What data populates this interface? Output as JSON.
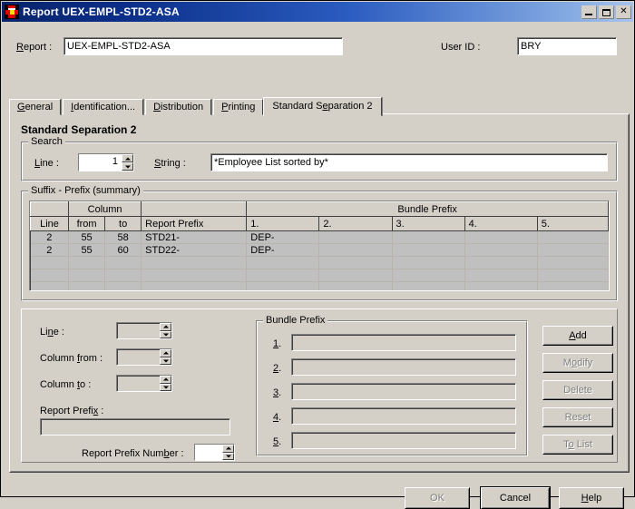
{
  "window": {
    "title": "Report UEX-EMPL-STD2-ASA",
    "icon": "report-document-icon",
    "controls": {
      "minimize": "minimize-icon",
      "maximize": "maximize-icon",
      "close": "✕"
    }
  },
  "header": {
    "report_label": "Report :",
    "report_label_accel": "R",
    "report_value": "UEX-EMPL-STD2-ASA",
    "userid_label": "User ID :",
    "userid_value": "BRY"
  },
  "tabs": [
    {
      "label": "General",
      "accel": "G",
      "active": false
    },
    {
      "label": "Identification...",
      "accel": "I",
      "active": false
    },
    {
      "label": "Distribution",
      "accel": "D",
      "active": false
    },
    {
      "label": "Printing",
      "accel": "P",
      "active": false
    },
    {
      "label": "Standard Separation 2",
      "accel": "e",
      "active": true
    }
  ],
  "panel": {
    "title": "Standard Separation 2"
  },
  "search_group": {
    "legend": "Search",
    "line_label": "Line :",
    "line_value": "1",
    "string_label": "String :",
    "string_value": "*Employee List sorted by*"
  },
  "summary_group": {
    "legend": "Suffix - Prefix (summary)",
    "header_top": {
      "blank_left": "",
      "column": "Column",
      "blank_mid": "",
      "bundle_prefix": "Bundle Prefix"
    },
    "columns": [
      "Line",
      "from",
      "to",
      "Report Prefix",
      "1.",
      "2.",
      "3.",
      "4.",
      "5."
    ],
    "rows": [
      {
        "line": "2",
        "from": "55",
        "to": "58",
        "report_prefix": "STD21-",
        "b1": "DEP-",
        "b2": "",
        "b3": "",
        "b4": "",
        "b5": "",
        "selected": true
      },
      {
        "line": "2",
        "from": "55",
        "to": "60",
        "report_prefix": "STD22-",
        "b1": "DEP-",
        "b2": "",
        "b3": "",
        "b4": "",
        "b5": "",
        "selected": true
      }
    ],
    "empty_rows": 4
  },
  "detail_form": {
    "line_label": "Line :",
    "line_value": "",
    "line_enabled": false,
    "column_from_label": "Column from :",
    "column_from_value": "",
    "column_from_enabled": false,
    "column_to_label": "Column to :",
    "column_to_value": "",
    "column_to_enabled": false,
    "report_prefix_label": "Report Prefix :",
    "report_prefix_value": "",
    "report_prefix_number_label": "Report Prefix Number :",
    "report_prefix_number_value": "",
    "report_prefix_number_enabled": true
  },
  "bundle_prefix_group": {
    "legend": "Bundle Prefix",
    "fields": [
      {
        "label": "1.",
        "accel": "1",
        "value": ""
      },
      {
        "label": "2.",
        "accel": "2",
        "value": ""
      },
      {
        "label": "3.",
        "accel": "3",
        "value": ""
      },
      {
        "label": "4.",
        "accel": "4",
        "value": ""
      },
      {
        "label": "5.",
        "accel": "5",
        "value": ""
      }
    ]
  },
  "action_buttons": [
    {
      "label": "Add",
      "accel": "A",
      "enabled": true
    },
    {
      "label": "Modify",
      "accel": "o",
      "enabled": false
    },
    {
      "label": "Delete",
      "accel": "",
      "enabled": false
    },
    {
      "label": "Reset",
      "accel": "",
      "enabled": false
    },
    {
      "label": "To List",
      "accel": "o",
      "enabled": false
    }
  ],
  "dialog_buttons": [
    {
      "label": "OK",
      "enabled": false,
      "default": false
    },
    {
      "label": "Cancel",
      "enabled": true,
      "default": true
    },
    {
      "label": "Help",
      "accel": "H",
      "enabled": true,
      "default": false
    }
  ],
  "colors": {
    "face": "#d4d0c8",
    "title_start": "#08246b",
    "title_end": "#a6c3ec",
    "selection": "#c0c0c0",
    "disabled_text": "#808080"
  }
}
